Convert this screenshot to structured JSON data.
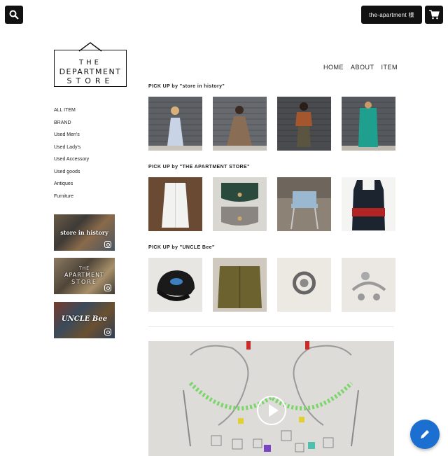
{
  "header": {
    "account_label": "the-apartment 様",
    "icons": {
      "search": "search-icon",
      "cart": "cart-icon"
    }
  },
  "logo": {
    "line1": "THE",
    "line2": "DEPARTMENT",
    "line3": "STORE"
  },
  "topnav": [
    "HOME",
    "ABOUT",
    "ITEM"
  ],
  "sidenav": [
    "ALL ITEM",
    "BRAND",
    "Used Men's",
    "Used Lady's",
    "Used Accessory",
    "Used goods",
    "Antiques",
    "Furniture"
  ],
  "banners": [
    {
      "text": "store in history"
    },
    {
      "text_line1": "THE",
      "text_line2": "APARTMENT",
      "text_line3": "STORE"
    },
    {
      "text": "UNCLE Bee"
    }
  ],
  "sections": [
    {
      "title": "PICK UP by \"store in history\""
    },
    {
      "title": "PICK UP by \"THE APARTMENT STORE\""
    },
    {
      "title": "PICK UP by \"UNCLE Bee\""
    }
  ],
  "colors": {
    "dark": "#111111",
    "fab": "#1a6fd1"
  }
}
